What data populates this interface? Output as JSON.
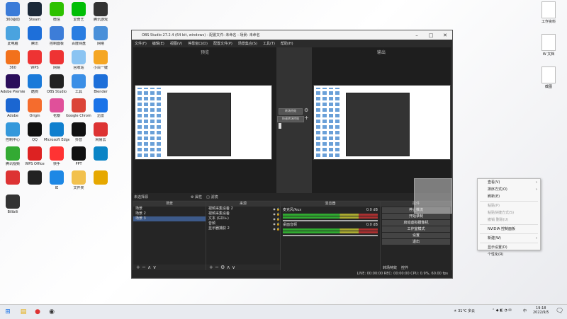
{
  "desktop": {
    "left_icons": [
      {
        "label": "360驱动",
        "color": "#3b7bd8"
      },
      {
        "label": "Steam",
        "color": "#1b2838"
      },
      {
        "label": "微信",
        "color": "#2dc100"
      },
      {
        "label": "爱奇艺",
        "color": "#00be06"
      },
      {
        "label": "腾讯游戏",
        "color": "#333"
      },
      {
        "label": "此电脑",
        "color": "#4aa3df"
      },
      {
        "label": "腾讯",
        "color": "#1e6fd9"
      },
      {
        "label": "控制面板",
        "color": "#3d7dd8"
      },
      {
        "label": "百度网盘",
        "color": "#2a7de1"
      },
      {
        "label": "网络",
        "color": "#4a90d9"
      },
      {
        "label": "360",
        "color": "#f2711c"
      },
      {
        "label": "WPS",
        "color": "#e33"
      },
      {
        "label": "网易",
        "color": "#e33"
      },
      {
        "label": "回收站",
        "color": "#8bc4f2"
      },
      {
        "label": "小白一键",
        "color": "#f5a623"
      },
      {
        "label": "Adobe Premie",
        "color": "#2a0d5a"
      },
      {
        "label": "酷狗",
        "color": "#1a7ad9"
      },
      {
        "label": "OBS Studio",
        "color": "#222"
      },
      {
        "label": "工具",
        "color": "#3a8ee6"
      },
      {
        "label": "Blender",
        "color": "#1d6fd9"
      },
      {
        "label": "Adobe",
        "color": "#1b66d1"
      },
      {
        "label": "Origin",
        "color": "#f56c2d"
      },
      {
        "label": "花瓣",
        "color": "#e0509a"
      },
      {
        "label": "Google Chrome",
        "color": "#db4437"
      },
      {
        "label": "迅雷",
        "color": "#1a73e8"
      },
      {
        "label": "控制中心",
        "color": "#3498db"
      },
      {
        "label": "QQ",
        "color": "#111"
      },
      {
        "label": "Microsoft Edge",
        "color": "#0f7fce"
      },
      {
        "label": "抖音",
        "color": "#111"
      },
      {
        "label": "网易云",
        "color": "#d33"
      },
      {
        "label": "腾讯视频",
        "color": "#3a3"
      },
      {
        "label": "WPS Office",
        "color": "#d22"
      },
      {
        "label": "快手",
        "color": "#f33"
      },
      {
        "label": "PPT",
        "color": "#111"
      },
      {
        "label": "",
        "color": "#0a84c6"
      },
      {
        "label": "",
        "color": "#d33"
      },
      {
        "label": "",
        "color": "#222"
      },
      {
        "label": "IE",
        "color": "#1e88e5"
      },
      {
        "label": "文件夹",
        "color": "#f2c14e"
      },
      {
        "label": "",
        "color": "#e6a800"
      },
      {
        "label": "Bilibili",
        "color": "#333"
      }
    ],
    "right_icons": [
      {
        "label": "工作资料"
      },
      {
        "label": "W 文档"
      },
      {
        "label": "截图"
      }
    ]
  },
  "obs": {
    "title": "OBS Studio 27.2.4 (64 bit, windows) - 配置文件: 未命名 - 场景: 未命名",
    "menu": [
      "文件(F)",
      "编辑(E)",
      "视图(V)",
      "停靠窗口(D)",
      "配置文件(P)",
      "场景集合(S)",
      "工具(T)",
      "帮助(H)"
    ],
    "preview_label": "预览",
    "program_label": "输出",
    "transition_button": "转场特效",
    "quick_transition": "快速转场特效",
    "no_source": "未选择源",
    "props_button": "属性",
    "filters_button": "滤镜",
    "docks": {
      "scenes": {
        "title": "场景",
        "items": [
          "场景",
          "场景 2",
          "场景 3"
        ],
        "selected": 2
      },
      "sources": {
        "title": "来源",
        "items": [
          "视频采集设备 2",
          "视频采集设备",
          "文本 (GDI+)",
          "音频",
          "显示器捕获 2"
        ]
      },
      "mixer": {
        "title": "混音器",
        "tracks": [
          {
            "name": "麦克风/Aux",
            "db": "0.0 dB"
          },
          {
            "name": "桌面音频",
            "db": "0.0 dB"
          }
        ]
      },
      "controls": {
        "title": "控件",
        "buttons": [
          "停止推流",
          "开始录制",
          "启动虚拟摄像机",
          "工作室模式",
          "设置",
          "退出"
        ]
      }
    },
    "dock_tabs": [
      "转场特效",
      "控件"
    ],
    "status": "LIVE: 00:00:00   REC: 00:00:00   CPU: 0.9%, 60.00 fps"
  },
  "context_menu": {
    "items": [
      {
        "label": "查看(V)",
        "submenu": true,
        "disabled": false
      },
      {
        "label": "排序方式(O)",
        "submenu": true,
        "disabled": false
      },
      {
        "label": "刷新(E)",
        "submenu": false,
        "disabled": false
      },
      {
        "sep": true
      },
      {
        "label": "粘贴(P)",
        "submenu": false,
        "disabled": true
      },
      {
        "label": "粘贴快捷方式(S)",
        "submenu": false,
        "disabled": true
      },
      {
        "label": "撤销 删除(U)",
        "submenu": false,
        "disabled": true
      },
      {
        "sep": true
      },
      {
        "label": "NVIDIA 控制面板",
        "submenu": false,
        "disabled": false
      },
      {
        "sep": true
      },
      {
        "label": "新建(W)",
        "submenu": true,
        "disabled": false
      },
      {
        "sep": true
      },
      {
        "label": "显示设置(D)",
        "submenu": false,
        "disabled": false
      },
      {
        "label": "个性化(R)",
        "submenu": false,
        "disabled": false
      }
    ]
  },
  "taskbar": {
    "weather": "31°C 多云",
    "time": "19:18",
    "date": "2022/9/5",
    "ime": "中"
  }
}
